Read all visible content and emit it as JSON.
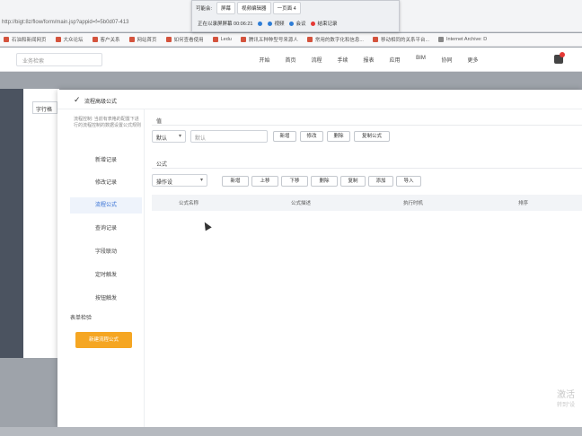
{
  "browser": {
    "url": "http://bigt:8z/flow/form/main.jsp?appid=f=5b0d07-413",
    "bookmarks": [
      {
        "label": "石油和新闻网页"
      },
      {
        "label": "大众论坛"
      },
      {
        "label": "客户关系"
      },
      {
        "label": "网站首页"
      },
      {
        "label": "如何查看使用"
      },
      {
        "label": "Ledu"
      },
      {
        "label": "腾讯五种种型号来源人"
      },
      {
        "label": "常用的数字化和信息..."
      },
      {
        "label": "移动相同的关系平台..."
      },
      {
        "label": "Internet Archive: D"
      }
    ]
  },
  "recorder": {
    "label": "可能会:",
    "tabs": [
      "屏幕",
      "视频编辑器",
      "一页面 4"
    ],
    "row2": [
      "正在以录屏屏幕 00:06:21",
      "",
      "视频",
      "会议",
      "结束记录"
    ]
  },
  "appnav": {
    "search_placeholder": "业务检索",
    "items": [
      "开始",
      "首页",
      "流程",
      "手续",
      "报表",
      "应用",
      "BIM",
      "协同",
      "更多"
    ]
  },
  "bgpage": {
    "button": "字行格"
  },
  "dialog": {
    "title": "流程高级公式",
    "hint": "流程控制: 当前有表格的配置下进行的流程控制的数据设置公式规则",
    "side_items": [
      "新增记录",
      "修改记录",
      "流程公式",
      "查询记录",
      "字段联动",
      "定时触发",
      "按钮触发"
    ],
    "side_plain": "表单检验",
    "side_button": "新建流程公式",
    "section1": {
      "label": "值",
      "select_value": "默认",
      "input_value": "默认",
      "buttons": [
        "新增",
        "修改",
        "删除",
        "复制公式"
      ]
    },
    "section2": {
      "label": "公式",
      "select_value": "操作设",
      "buttons": [
        "新增",
        "上移",
        "下移",
        "删除",
        "复制",
        "添加",
        "导入"
      ],
      "columns": [
        "公式名称",
        "公式描述",
        "执行时机",
        "排序"
      ]
    }
  },
  "watermark": {
    "line1": "激活",
    "line2": "转到\"设"
  }
}
